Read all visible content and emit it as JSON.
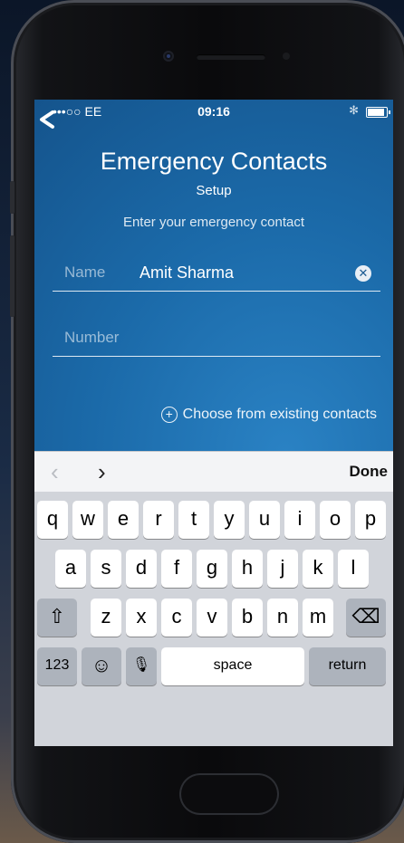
{
  "status_bar": {
    "carrier": "•••○○ EE",
    "time": "09:16",
    "bluetooth_icon": "bluetooth-icon"
  },
  "screen": {
    "title": "Emergency Contacts",
    "subtitle": "Setup",
    "instruction": "Enter your emergency contact",
    "name_field": {
      "label": "Name",
      "value": "Amit Sharma"
    },
    "number_field": {
      "placeholder": "Number",
      "value": ""
    },
    "choose_link": "Choose from existing contacts"
  },
  "keyboard_toolbar": {
    "prev": "‹",
    "next": "›",
    "done": "Done"
  },
  "keyboard": {
    "row1": [
      "q",
      "w",
      "e",
      "r",
      "t",
      "y",
      "u",
      "i",
      "o",
      "p"
    ],
    "row2": [
      "a",
      "s",
      "d",
      "f",
      "g",
      "h",
      "j",
      "k",
      "l"
    ],
    "row3": [
      "z",
      "x",
      "c",
      "v",
      "b",
      "n",
      "m"
    ],
    "shift": "⇧",
    "delete": "⌫",
    "numbers": "123",
    "emoji": "☺",
    "mic": "🎙",
    "space": "space",
    "return": "return"
  },
  "colors": {
    "screen_blue": "#1b6aa9",
    "keyboard_bg": "#d1d4da"
  }
}
